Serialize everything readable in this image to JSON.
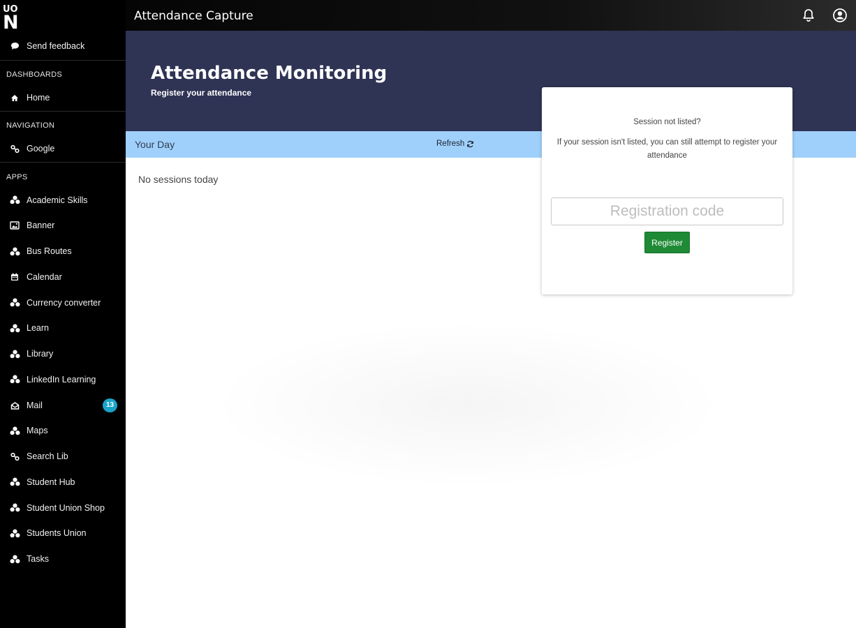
{
  "app": {
    "title": "Attendance Capture"
  },
  "sidebar": {
    "feedback_label": "Send feedback",
    "sections": {
      "dashboards": "DASHBOARDS",
      "navigation": "NAVIGATION",
      "apps": "APPS"
    },
    "dashboards": [
      {
        "label": "Home",
        "icon": "home-icon"
      }
    ],
    "navigation": [
      {
        "label": "Google",
        "icon": "link-icon"
      }
    ],
    "apps": [
      {
        "label": "Academic Skills",
        "icon": "apps-icon"
      },
      {
        "label": "Banner",
        "icon": "image-icon"
      },
      {
        "label": "Bus Routes",
        "icon": "apps-icon"
      },
      {
        "label": "Calendar",
        "icon": "calendar-icon"
      },
      {
        "label": "Currency converter",
        "icon": "apps-icon"
      },
      {
        "label": "Learn",
        "icon": "apps-icon"
      },
      {
        "label": "Library",
        "icon": "apps-icon"
      },
      {
        "label": "LinkedIn Learning",
        "icon": "apps-icon"
      },
      {
        "label": "Mail",
        "icon": "mail-icon",
        "badge": "13"
      },
      {
        "label": "Maps",
        "icon": "apps-icon"
      },
      {
        "label": "Search Lib",
        "icon": "link-icon"
      },
      {
        "label": "Student Hub",
        "icon": "apps-icon"
      },
      {
        "label": "Student Union Shop",
        "icon": "apps-icon"
      },
      {
        "label": "Students Union",
        "icon": "apps-icon"
      },
      {
        "label": "Tasks",
        "icon": "apps-icon"
      }
    ]
  },
  "hero": {
    "title": "Attendance Monitoring",
    "subtitle": "Register your attendance"
  },
  "day": {
    "label": "Your Day",
    "refresh_label": "Refresh",
    "empty_message": "No sessions today"
  },
  "card": {
    "question": "Session not listed?",
    "description": "If your session isn't listed, you can still attempt to register your attendance",
    "input_placeholder": "Registration code",
    "input_value": "",
    "button_label": "Register"
  },
  "colors": {
    "sidebar_bg": "#000000",
    "hero_bg": "#2f3354",
    "daybar_bg": "#9fd0fb",
    "register_button": "#1e8a35",
    "badge": "#1aa3c9"
  }
}
